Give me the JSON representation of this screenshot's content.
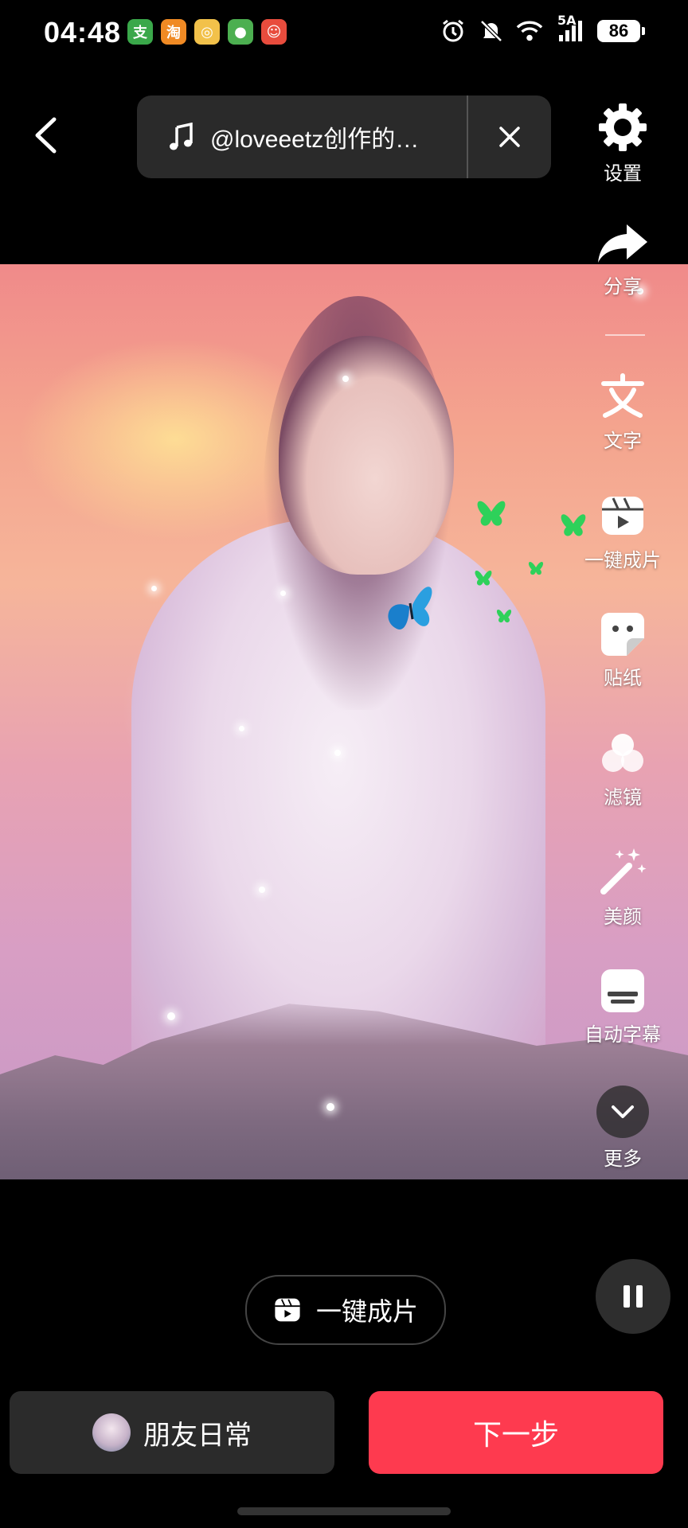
{
  "status_bar": {
    "time": "04:48",
    "network": "5A",
    "battery": "86",
    "notification_icons": [
      "bank-app-icon",
      "shopping-app-icon",
      "weibo-icon",
      "wechat-style-icon",
      "red-app-icon"
    ]
  },
  "header": {
    "music_label": "@loveeetz创作的…"
  },
  "sidebar": {
    "items": [
      {
        "label": "设置",
        "icon": "gear-icon"
      },
      {
        "label": "分享",
        "icon": "share-icon"
      },
      {
        "label": "文字",
        "icon": "text-icon"
      },
      {
        "label": "一键成片",
        "icon": "clapperboard-icon"
      },
      {
        "label": "贴纸",
        "icon": "sticker-icon"
      },
      {
        "label": "滤镜",
        "icon": "filter-icon"
      },
      {
        "label": "美颜",
        "icon": "magic-wand-icon"
      },
      {
        "label": "自动字幕",
        "icon": "subtitle-icon"
      },
      {
        "label": "更多",
        "icon": "chevron-down-icon"
      }
    ]
  },
  "bottom": {
    "oneclick_label": "一键成片",
    "friends_label": "朋友日常",
    "next_label": "下一步"
  },
  "colors": {
    "accent": "#fe3a4f",
    "pill_bg": "#2a2a2a"
  }
}
